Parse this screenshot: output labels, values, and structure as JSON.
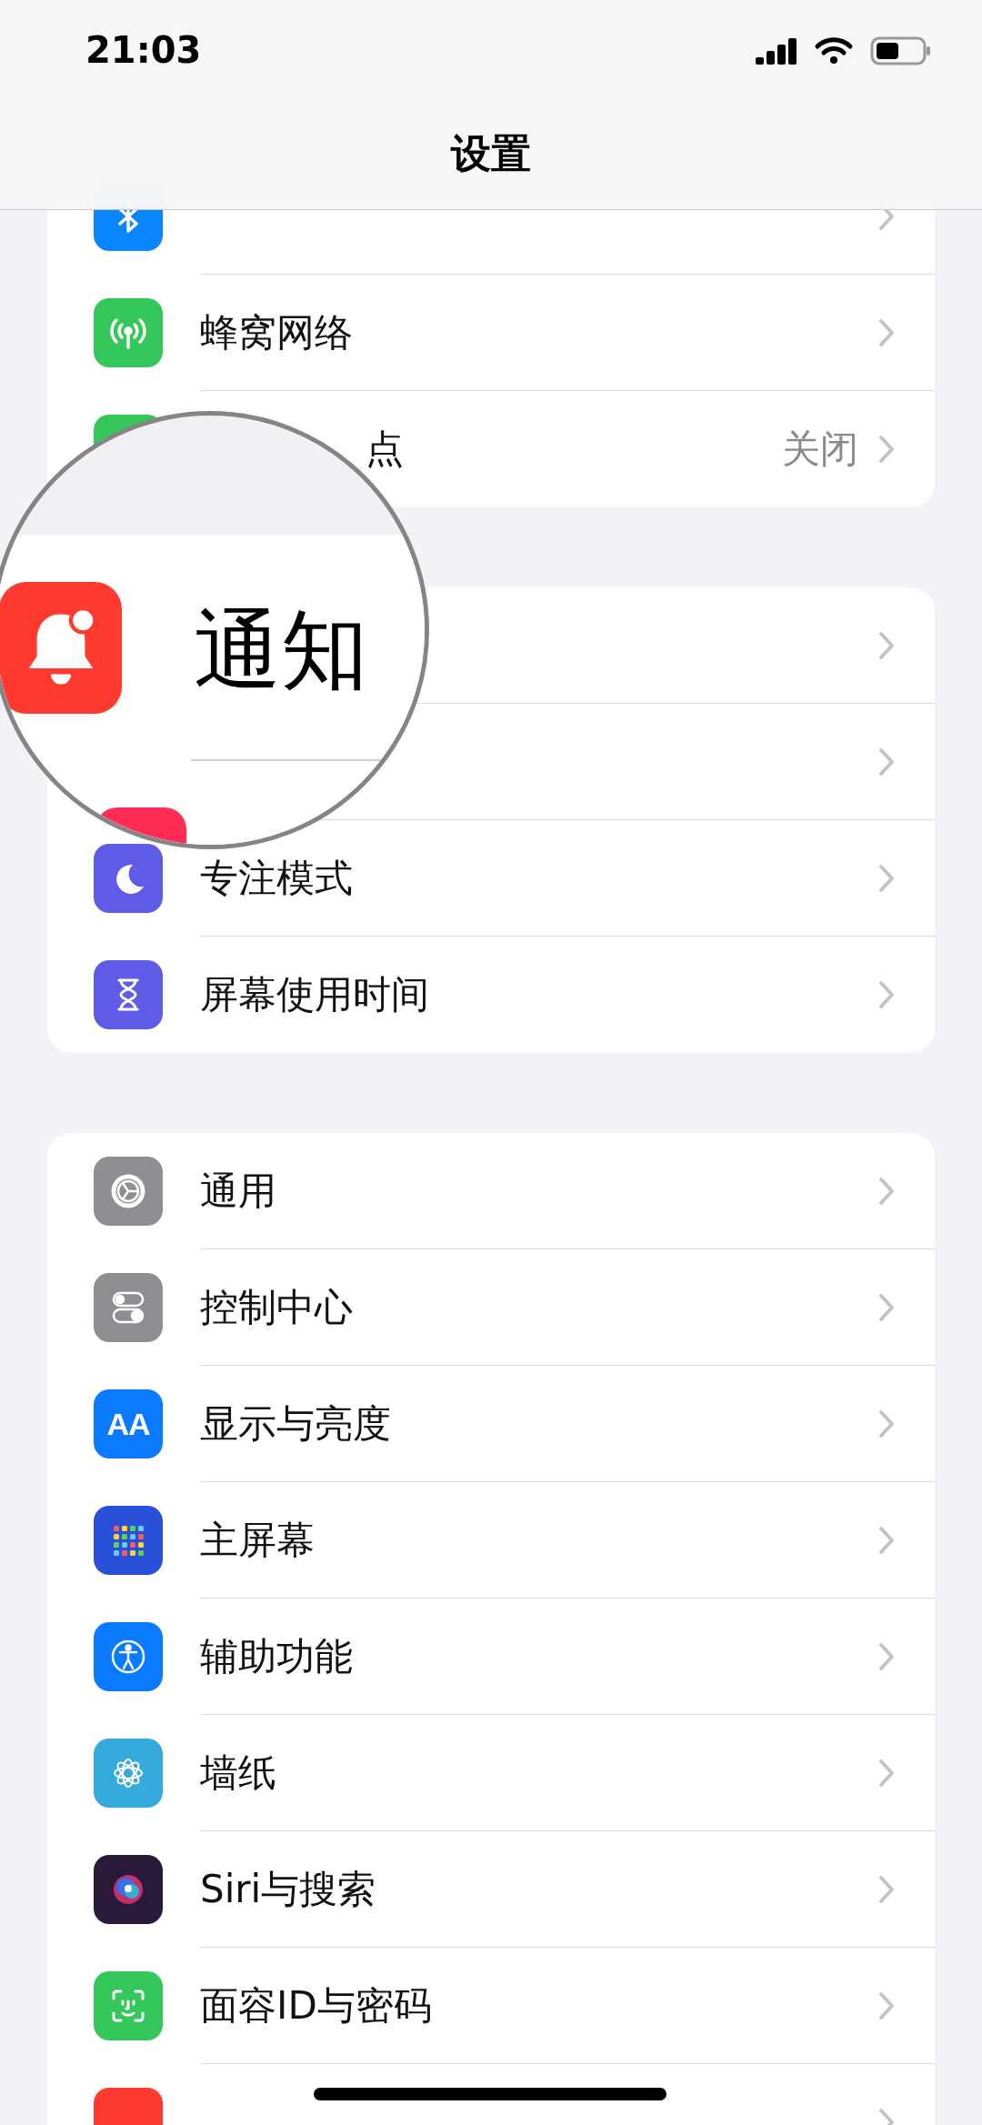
{
  "status_bar": {
    "time": "21:03"
  },
  "nav": {
    "title": "设置"
  },
  "groups": [
    {
      "rows": [
        {
          "label": "蜂窝网络"
        },
        {
          "label": "点",
          "value": "关闭"
        }
      ]
    },
    {
      "rows": [
        {
          "label": "专注模式"
        },
        {
          "label": "屏幕使用时间"
        }
      ]
    },
    {
      "rows": [
        {
          "label": "通用"
        },
        {
          "label": "控制中心"
        },
        {
          "label": "显示与亮度",
          "icon_text": "AA"
        },
        {
          "label": "主屏幕"
        },
        {
          "label": "辅助功能"
        },
        {
          "label": "墙纸"
        },
        {
          "label": "Siri与搜索"
        },
        {
          "label": "面容ID与密码"
        }
      ]
    }
  ],
  "magnifier": {
    "label": "通知"
  }
}
